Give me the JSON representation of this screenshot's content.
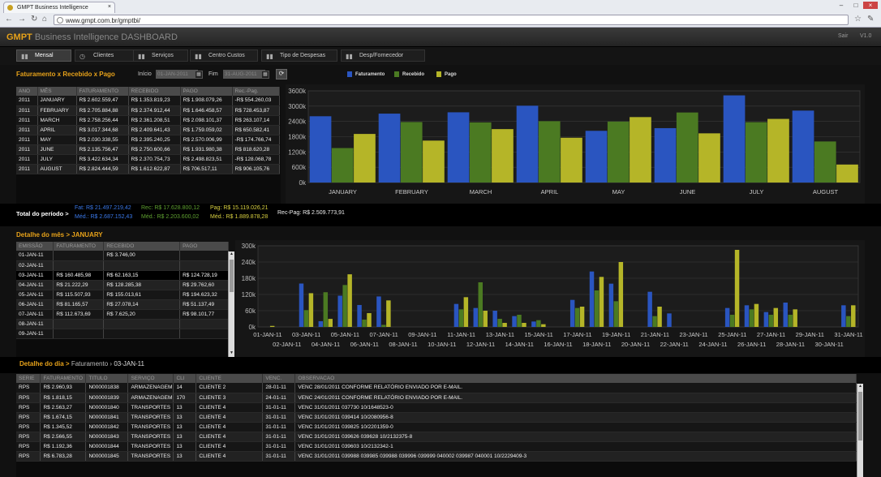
{
  "browser": {
    "tab_title": "GMPT Business Intelligence",
    "url": "www.gmpt.com.br/gmptbi/"
  },
  "app": {
    "brand_gmpt": "GMPT",
    "brand_rest": "Business Intelligence DASHBOARD",
    "exit": "Sair",
    "version": "V1.0"
  },
  "nav": {
    "tabs": [
      {
        "label": "Mensal",
        "active": true
      },
      {
        "label": "Clientes"
      },
      {
        "label": "Serviços"
      },
      {
        "label": "Centro Custos"
      },
      {
        "label": "Tipo de Despesas"
      },
      {
        "label": "Desp/Fornecedor"
      }
    ]
  },
  "section1": {
    "title": "Faturamento x Recebido x Pago",
    "start_label": "Início",
    "start_value": "01-JAN-2011",
    "end_label": "Fim",
    "end_value": "31-AUG-2011",
    "legend": [
      "Faturamento",
      "Recebido",
      "Pago"
    ]
  },
  "monthly_table": {
    "headers": [
      "ANO",
      "MÊS",
      "FATURAMENTO",
      "RECEBIDO",
      "PAGO",
      "Rec.-Pag."
    ],
    "rows": [
      [
        "2011",
        "JANUARY",
        "R$ 2.602.559,47",
        "R$ 1.353.819,23",
        "R$ 1.908.079,26",
        "-R$ 554.260,03"
      ],
      [
        "2011",
        "FEBRUARY",
        "R$ 2.705.884,88",
        "R$ 2.374.912,44",
        "R$ 1.646.458,57",
        "R$ 728.453,87"
      ],
      [
        "2011",
        "MARCH",
        "R$ 2.758.256,44",
        "R$ 2.361.208,51",
        "R$ 2.098.101,37",
        "R$ 263.107,14"
      ],
      [
        "2011",
        "APRIL",
        "R$ 3.017.344,68",
        "R$ 2.409.641,43",
        "R$ 1.759.059,02",
        "R$ 650.582,41"
      ],
      [
        "2011",
        "MAY",
        "R$ 2.030.338,55",
        "R$ 2.395.240,25",
        "R$ 2.570.006,99",
        "-R$ 174.766,74"
      ],
      [
        "2011",
        "JUNE",
        "R$ 2.135.756,47",
        "R$ 2.750.600,66",
        "R$ 1.931.980,38",
        "R$ 818.620,28"
      ],
      [
        "2011",
        "JULY",
        "R$ 3.422.634,34",
        "R$ 2.370.754,73",
        "R$ 2.498.823,51",
        "-R$ 128.068,78"
      ],
      [
        "2011",
        "AUGUST",
        "R$ 2.824.444,59",
        "R$ 1.612.622,87",
        "R$ 706.517,11",
        "R$ 906.105,76"
      ]
    ]
  },
  "totals": {
    "label": "Total do período >",
    "fat": "Fat: R$ 21.497.219,42",
    "rec": "Rec: R$ 17.628.800,12",
    "pag": "Pag: R$ 15.119.026,21",
    "recpag": "Rec-Pag: R$ 2.509.773,91",
    "med_fat": "Méd.: R$ 2.687.152,43",
    "med_rec": "Méd.: R$ 2.203.600,02",
    "med_pag": "Méd.: R$ 1.889.878,28"
  },
  "section2": {
    "title_prefix": "Detalhe do mês >",
    "title_month": "JANUARY"
  },
  "daily_table": {
    "headers": [
      "EMISSÃO",
      "FATURAMENTO",
      "RECEBIDO",
      "PAGO"
    ],
    "rows": [
      [
        "01-JAN-11",
        "",
        "R$ 3.746,00",
        ""
      ],
      [
        "02-JAN-11",
        "",
        "",
        ""
      ],
      [
        "03-JAN-11",
        "R$ 160.485,98",
        "R$ 62.163,15",
        "R$ 124.728,19"
      ],
      [
        "04-JAN-11",
        "R$ 21.222,29",
        "R$ 128.285,38",
        "R$ 29.762,60"
      ],
      [
        "05-JAN-11",
        "R$ 115.507,93",
        "R$ 155.013,61",
        "R$ 194.623,32"
      ],
      [
        "06-JAN-11",
        "R$ 81.165,57",
        "R$ 27.078,14",
        "R$ 51.137,49"
      ],
      [
        "07-JAN-11",
        "R$ 112.673,69",
        "R$ 7.625,20",
        "R$ 98.101,77"
      ],
      [
        "08-JAN-11",
        "",
        "",
        ""
      ],
      [
        "09-JAN-11",
        "",
        "",
        ""
      ]
    ]
  },
  "section3": {
    "title_prefix": "Detalhe do dia >",
    "title_mid": "Faturamento",
    "title_date": "03-JAN-11"
  },
  "detail_table": {
    "headers": [
      "SERIE",
      "FATURAMENTO",
      "TITULO",
      "SERVIÇO",
      "CLI",
      "CLIENTE",
      "VENC.",
      "OBSERVACAO"
    ],
    "rows": [
      [
        "RPS",
        "R$ 2.960,93",
        "N000001838",
        "ARMAZENAGEM",
        "14",
        "CLIENTE 2",
        "28-01-11",
        "VENC 28/01/2011          CONFORME RELATÓRIO ENVIADO POR E-MAIL."
      ],
      [
        "RPS",
        "R$ 1.818,15",
        "N000001839",
        "ARMAZENAGEM",
        "170",
        "CLIENTE 3",
        "24-01-11",
        "VENC 24/01/2011  CONFORME RELATÓRIO ENVIADO POR E-MAIL."
      ],
      [
        "RPS",
        "R$ 2.563,27",
        "N000001840",
        "TRANSPORTES",
        "13",
        "CLIENTE 4",
        "31-01-11",
        "VENC  31/01/2011          037730        10/1648523-0"
      ],
      [
        "RPS",
        "R$ 1.674,15",
        "N000001841",
        "TRANSPORTES",
        "13",
        "CLIENTE 4",
        "31-01-11",
        "VENC  31/01/2011          039414        10/2080956-8"
      ],
      [
        "RPS",
        "R$ 1.345,52",
        "N000001842",
        "TRANSPORTES",
        "13",
        "CLIENTE 4",
        "31-01-11",
        "VENC  31/01/2011          039825        10/2201359-0"
      ],
      [
        "RPS",
        "R$ 2.566,55",
        "N000001843",
        "TRANSPORTES",
        "13",
        "CLIENTE 4",
        "31-01-11",
        "VENC  31/01/2011          039626   039628       10/2132375-8"
      ],
      [
        "RPS",
        "R$ 1.192,36",
        "N000001844",
        "TRANSPORTES",
        "13",
        "CLIENTE 4",
        "31-01-11",
        "VENC  31/01/2011          039603        10/2132342-1"
      ],
      [
        "RPS",
        "R$ 6.783,28",
        "N000001845",
        "TRANSPORTES",
        "13",
        "CLIENTE 4",
        "31-01-11",
        "VENC  31/01/2011   039988   039985   039988   039996   039999   040002   039987   040001     10/2229409-3"
      ]
    ]
  },
  "colors": {
    "faturamento": "#2a55c0",
    "recebido": "#4b7a22",
    "pago": "#b5b528",
    "accent": "#e7a21a"
  },
  "chart_data": [
    {
      "type": "bar",
      "categories": [
        "JANUARY",
        "FEBRUARY",
        "MARCH",
        "APRIL",
        "MAY",
        "JUNE",
        "JULY",
        "AUGUST"
      ],
      "series": [
        {
          "name": "Faturamento",
          "values": [
            2602559,
            2705885,
            2758256,
            3017345,
            2030339,
            2135756,
            3422634,
            2824445
          ]
        },
        {
          "name": "Recebido",
          "values": [
            1353819,
            2374912,
            2361209,
            2409641,
            2395240,
            2750601,
            2370755,
            1612623
          ]
        },
        {
          "name": "Pago",
          "values": [
            1908079,
            1646459,
            2098101,
            1759059,
            2570007,
            1931980,
            2498824,
            706517
          ]
        }
      ],
      "yticks": [
        "0k",
        "600k",
        "1200k",
        "1800k",
        "2400k",
        "3000k",
        "3600k"
      ],
      "ylim": [
        0,
        3600000
      ],
      "grid": true,
      "legend": "top"
    },
    {
      "type": "bar",
      "categories": [
        "01-JAN-11",
        "02-JAN-11",
        "03-JAN-11",
        "04-JAN-11",
        "05-JAN-11",
        "06-JAN-11",
        "07-JAN-11",
        "08-JAN-11",
        "09-JAN-11",
        "10-JAN-11",
        "11-JAN-11",
        "12-JAN-11",
        "13-JAN-11",
        "14-JAN-11",
        "15-JAN-11",
        "16-JAN-11",
        "17-JAN-11",
        "18-JAN-11",
        "19-JAN-11",
        "20-JAN-11",
        "21-JAN-11",
        "22-JAN-11",
        "23-JAN-11",
        "24-JAN-11",
        "25-JAN-11",
        "26-JAN-11",
        "27-JAN-11",
        "28-JAN-11",
        "29-JAN-11",
        "30-JAN-11",
        "31-JAN-11"
      ],
      "series": [
        {
          "name": "Faturamento",
          "values": [
            0,
            0,
            160486,
            21222,
            115508,
            81166,
            112674,
            0,
            0,
            0,
            85000,
            70000,
            60000,
            40000,
            20000,
            0,
            100000,
            205000,
            160000,
            0,
            130000,
            50000,
            0,
            0,
            70000,
            80000,
            55000,
            90000,
            0,
            0,
            80000
          ]
        },
        {
          "name": "Recebido",
          "values": [
            0,
            0,
            62163,
            128285,
            155014,
            27078,
            7625,
            0,
            0,
            0,
            65000,
            165000,
            30000,
            45000,
            25000,
            0,
            70000,
            135000,
            95000,
            0,
            40000,
            0,
            0,
            0,
            45000,
            65000,
            45000,
            45000,
            0,
            0,
            40000
          ]
        },
        {
          "name": "Pago",
          "values": [
            3746,
            0,
            124728,
            29763,
            194623,
            51137,
            98102,
            0,
            0,
            0,
            110000,
            60000,
            15000,
            15000,
            10000,
            0,
            75000,
            185000,
            240000,
            0,
            75000,
            0,
            0,
            0,
            285000,
            85000,
            70000,
            65000,
            0,
            0,
            80000
          ]
        }
      ],
      "yticks": [
        "0k",
        "60k",
        "120k",
        "180k",
        "240k",
        "300k"
      ],
      "ylim": [
        0,
        300000
      ],
      "grid": true
    }
  ]
}
